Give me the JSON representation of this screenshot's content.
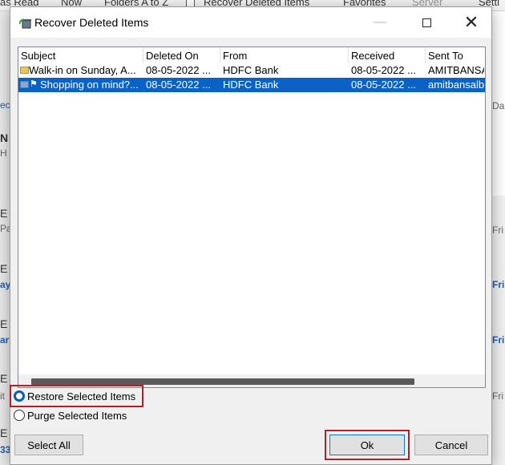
{
  "background": {
    "ribbon": [
      {
        "label": "as Read",
        "disabled": false
      },
      {
        "label": "Now",
        "disabled": false
      },
      {
        "label": "Folders A to Z",
        "disabled": false
      },
      {
        "label": "Recover Deleted Items",
        "disabled": false
      },
      {
        "label": "Favorites",
        "disabled": false
      },
      {
        "label": "Server",
        "disabled": true
      },
      {
        "label": "Setti",
        "disabled": false
      }
    ],
    "left_fragments": [
      "ec",
      "N",
      "H",
      "E",
      "Pa",
      "E",
      "ay",
      "E",
      "ar",
      "E",
      "it",
      "E",
      "33"
    ],
    "right_fragments": [
      "Da",
      "Fri",
      "Fri",
      "Fri",
      "Fri"
    ]
  },
  "dialog": {
    "title": "Recover Deleted Items",
    "minimize_glyph": "—",
    "close_glyph": "✕",
    "columns": [
      "Subject",
      "Deleted On",
      "From",
      "Received",
      "Sent To"
    ],
    "items": [
      {
        "subject": "Walk-in on Sunday, A...",
        "deleted_on": "08-05-2022 ...",
        "from": "HDFC Bank",
        "received": "08-05-2022 ...",
        "sent_to": "AMITBANSA",
        "icon": "closed-envelope-icon",
        "selected": false
      },
      {
        "subject": "Shopping on mind?...",
        "deleted_on": "08-05-2022 ...",
        "from": "HDFC Bank",
        "received": "08-05-2022 ...",
        "sent_to": "amitbansalbp",
        "icon": "open-envelope-icon",
        "selected": true
      }
    ],
    "options": {
      "restore_label": "Restore Selected Items",
      "purge_label": "Purge Selected Items",
      "selected": "restore"
    },
    "buttons": {
      "select_all": "Select All",
      "ok": "Ok",
      "cancel": "Cancel"
    }
  },
  "colors": {
    "selection": "#0a62c7",
    "highlight_annotation": "#b3202b",
    "link_blue": "#1f5fb8"
  }
}
